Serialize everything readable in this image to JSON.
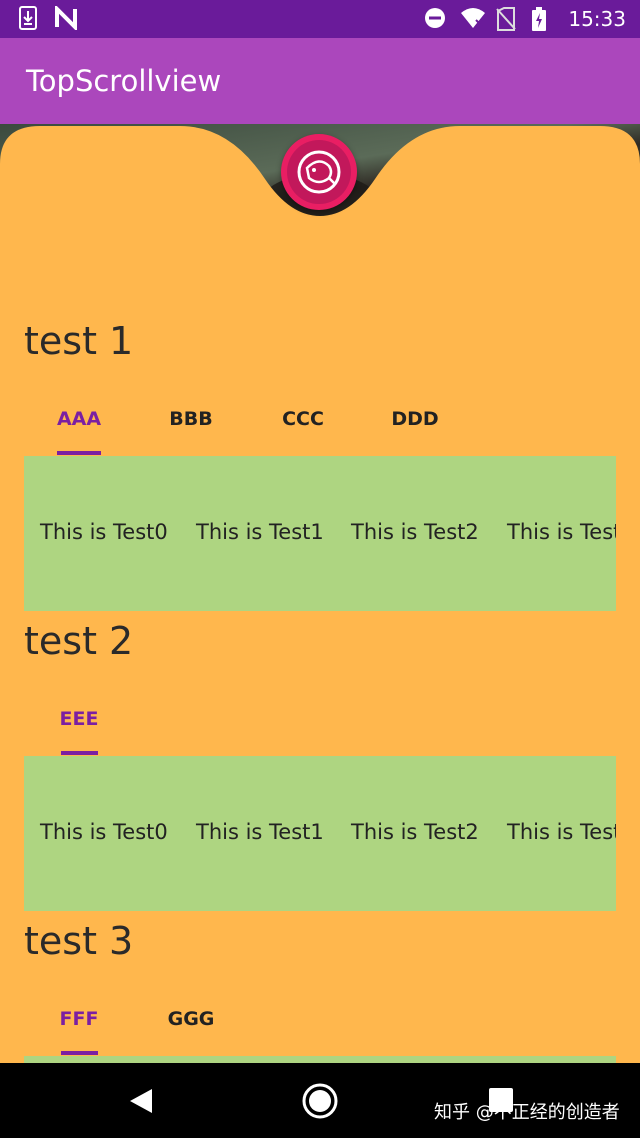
{
  "status_bar": {
    "time": "15:33",
    "left_icons": [
      "download-icon",
      "n-logo-icon"
    ],
    "right_icons": [
      "do-not-disturb-icon",
      "wifi-icon",
      "no-sim-icon",
      "battery-charging-icon"
    ]
  },
  "app_bar": {
    "title": "TopScrollview"
  },
  "fab": {
    "icon": "fish-icon"
  },
  "sections": [
    {
      "title": "test 1",
      "tabs": [
        {
          "label": "AAA",
          "active": true
        },
        {
          "label": "BBB",
          "active": false
        },
        {
          "label": "CCC",
          "active": false
        },
        {
          "label": "DDD",
          "active": false
        }
      ],
      "items": [
        "This is Test0",
        "This is Test1",
        "This is Test2",
        "This is Test"
      ]
    },
    {
      "title": "test 2",
      "tabs": [
        {
          "label": "EEE",
          "active": true
        }
      ],
      "items": [
        "This is Test0",
        "This is Test1",
        "This is Test2",
        "This is Test"
      ]
    },
    {
      "title": "test 3",
      "tabs": [
        {
          "label": "FFF",
          "active": true
        },
        {
          "label": "GGG",
          "active": false
        }
      ],
      "items": []
    }
  ],
  "nav_bar": {
    "buttons": [
      "back-icon",
      "home-icon",
      "recents-icon"
    ],
    "watermark": "知乎 @不正经的创造者"
  },
  "colors": {
    "status_bar": "#6a1b9a",
    "app_bar": "#ab47bc",
    "background": "#ffb74d",
    "panel": "#aed581",
    "tab_active": "#7b1fa2",
    "fab": "#e91e63"
  }
}
